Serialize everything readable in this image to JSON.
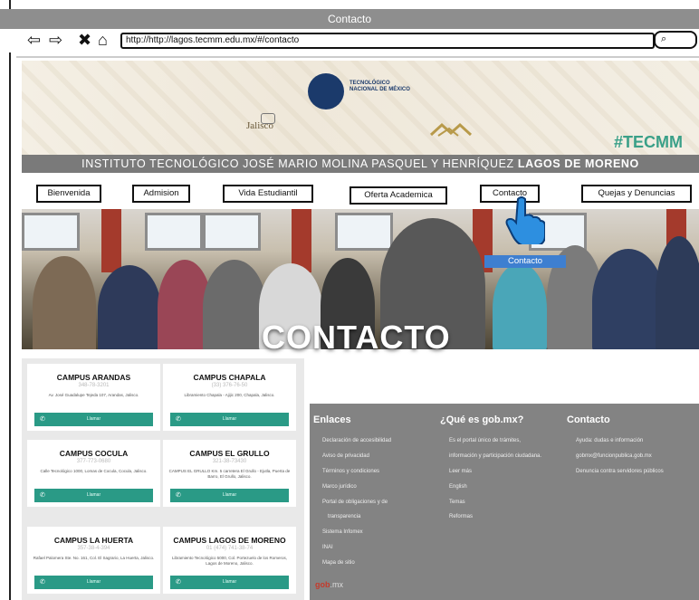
{
  "window": {
    "title": "Contacto"
  },
  "browser": {
    "url": "http://http://lagos.tecmm.edu.mx/#/contacto",
    "icons": [
      "back-arrow-icon",
      "forward-arrow-icon",
      "close-icon",
      "home-icon",
      "search-icon"
    ]
  },
  "header": {
    "tnm_line1": "TECNOLÓGICO",
    "tnm_line2": "NACIONAL DE MÉXICO",
    "jalisco": "Jalisco",
    "hashtag": "#TECMM",
    "institute_prefix": "INSTITUTO TECNOLÓGICO JOSÉ MARIO MOLINA PASQUEL Y HENRÍQUEZ ",
    "institute_bold": "LAGOS DE MORENO"
  },
  "menu": {
    "bienvenida": "Bienvenida",
    "admision": "Admision",
    "vida": "Vida Estudiantil",
    "oferta": "Oferta Academica",
    "contacto": "Contacto",
    "quejas": "Quejas y Denuncias"
  },
  "hero": {
    "title": "CONTACTO",
    "hover_label": "Contacto"
  },
  "campuses": [
    {
      "name": "CAMPUS ARANDAS",
      "phone": "348-78-3201",
      "address": "Av. José Guadalupe Tejeda 107, Arandas, Jalisco.",
      "button": "Llamar"
    },
    {
      "name": "CAMPUS CHAPALA",
      "phone": "(33) 376-76-50",
      "address": "Libramiento Chapala - Ajijic 200, Chapala, Jalisco.",
      "button": "Llamar"
    },
    {
      "name": "CAMPUS COCULA",
      "phone": "377-773-0680",
      "address": "Calle Tecnológico 1000, Lomas de Cocula, Cocula, Jalisco.",
      "button": "Llamar"
    },
    {
      "name": "CAMPUS EL GRULLO",
      "phone": "321-38-73430",
      "address": "CAMPUS EL GRULLO Km. 5 carretera El Grullo - Ejutla, Puerta de Barro, El Grullo, Jalisco.",
      "button": "Llamar"
    },
    {
      "name": "CAMPUS LA HUERTA",
      "phone": "357-38-4-394",
      "address": "Rafael Palomera Ste. No. 161, Col. El Sagrario, La Huerta, Jalisco.",
      "button": "Llamar"
    },
    {
      "name": "CAMPUS LAGOS DE MORENO",
      "phone": "01 (474) 741-38-74",
      "address": "Libramiento Tecnológico 5000, Col. Portezuelo de los Romeros, Lagos de Moreno, Jalisco.",
      "button": "Llamar"
    }
  ],
  "footer": {
    "col1_title": "Enlaces",
    "col1_items": [
      "Declaración de accesibilidad",
      "Aviso de privacidad",
      "Términos y condiciones",
      "Marco jurídico",
      "Portal de obligaciones y de",
      "transparencia",
      "Sistema Infomex",
      "INAI",
      "Mapa de sitio"
    ],
    "col2_title": "¿Qué es gob.mx?",
    "col2_items": [
      "Es el portal único de trámites,",
      "información y participación ciudadana.",
      "Leer más",
      "English",
      "Temas",
      "Reformas"
    ],
    "col3_title": "Contacto",
    "col3_items": [
      "Ayuda: dudas e información",
      "gobmx@funcionpublica.gob.mx",
      "Denuncia contra servidores públicos"
    ],
    "gob_logo": "gob",
    "gob_suffix": ".mx"
  },
  "colors": {
    "teal": "#2a9a86",
    "footer_gray": "#838383",
    "institute_bar": "#7a7a7a",
    "highlight_blue": "#3e7fd0",
    "hashtag_green": "#3aa088"
  }
}
